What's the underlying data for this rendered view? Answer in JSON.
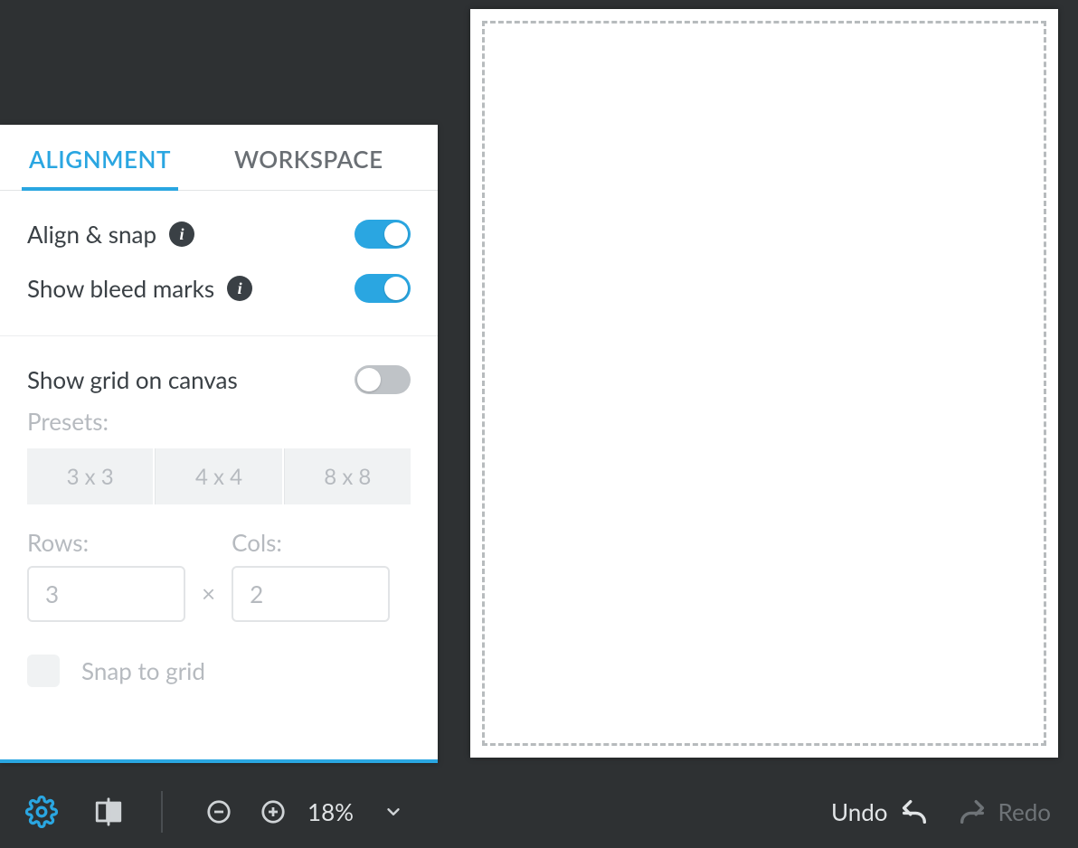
{
  "panel": {
    "tabs": {
      "alignment": "ALIGNMENT",
      "workspace": "WORKSPACE",
      "active": "alignment"
    },
    "align_snap": {
      "label": "Align & snap",
      "on": true
    },
    "bleed": {
      "label": "Show bleed marks",
      "on": true
    },
    "grid": {
      "label": "Show grid on canvas",
      "on": false
    },
    "presets": {
      "title": "Presets:",
      "options": [
        "3 x 3",
        "4 x 4",
        "8 x 8"
      ]
    },
    "rows": {
      "label": "Rows:",
      "value": "3"
    },
    "cols": {
      "label": "Cols:",
      "value": "2"
    },
    "rc_sep": "×",
    "snap_to_grid": {
      "label": "Snap to grid",
      "checked": false
    }
  },
  "bottombar": {
    "zoom": "18%",
    "undo": "Undo",
    "redo": "Redo"
  },
  "colors": {
    "accent": "#2aa6e1"
  }
}
